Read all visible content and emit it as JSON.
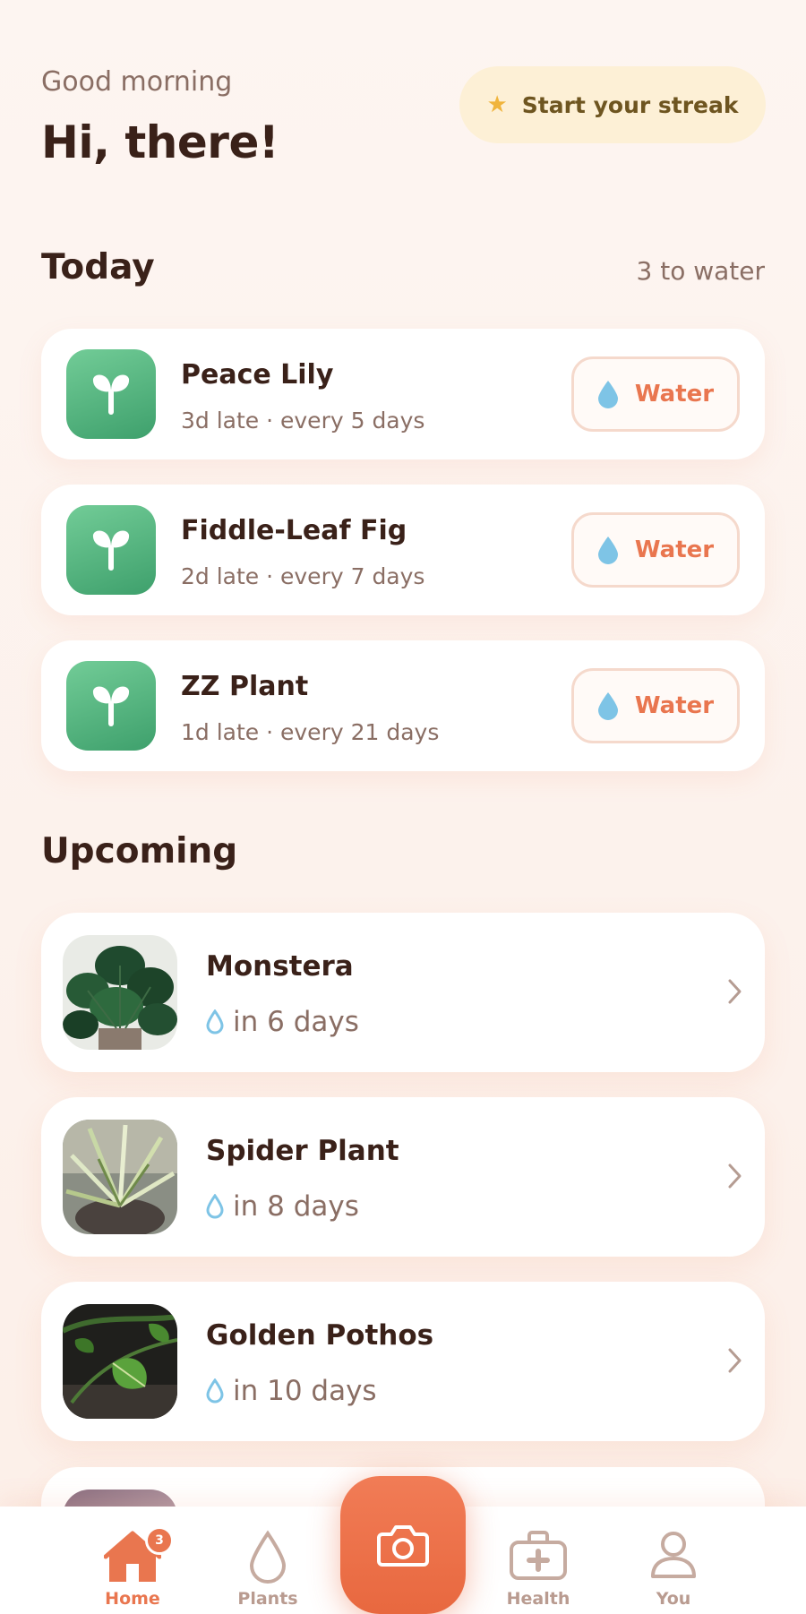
{
  "header": {
    "greeting": "Good morning",
    "title": "Hi, there!",
    "streak_label": "Start your streak",
    "streak_icon": "star-icon"
  },
  "today": {
    "title": "Today",
    "meta": "3 to water",
    "water_label": "Water",
    "items": [
      {
        "name": "Peace Lily",
        "status": "3d late · every 5 days"
      },
      {
        "name": "Fiddle-Leaf Fig",
        "status": "2d late · every 7 days"
      },
      {
        "name": "ZZ Plant",
        "status": "1d late · every 21 days"
      }
    ]
  },
  "upcoming": {
    "title": "Upcoming",
    "items": [
      {
        "name": "Monstera",
        "due": "in 6 days"
      },
      {
        "name": "Spider Plant",
        "due": "in 8 days"
      },
      {
        "name": "Golden Pothos",
        "due": "in 10 days"
      }
    ]
  },
  "nav": {
    "home": "Home",
    "home_badge": "3",
    "plants": "Plants",
    "health": "Health",
    "you": "You"
  },
  "colors": {
    "accent": "#e9764f",
    "plant_green": "#4caf7a",
    "water_blue": "#7ec4e6",
    "streak_bg": "#fdf0d6"
  }
}
